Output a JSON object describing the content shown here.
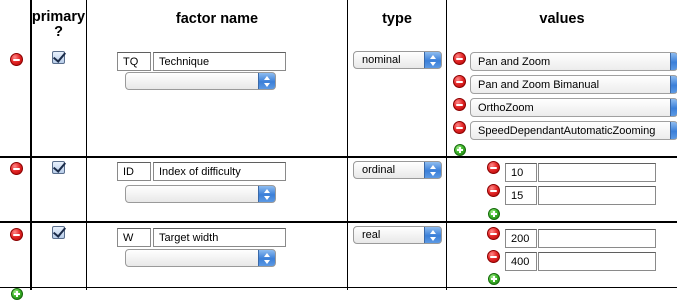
{
  "headers": {
    "primary": "primary",
    "primary_q": "?",
    "factor_name": "factor name",
    "type": "type",
    "values": "values"
  },
  "factors": [
    {
      "primary_checked": true,
      "code": "TQ",
      "name": "Technique",
      "type": "nominal",
      "values": [
        "Pan and Zoom",
        "Pan and Zoom Bimanual",
        "OrthoZoom",
        "SpeedDependantAutomaticZooming"
      ]
    },
    {
      "primary_checked": true,
      "code": "ID",
      "name": "Index of difficulty",
      "type": "ordinal",
      "values": [
        "10",
        "15"
      ]
    },
    {
      "primary_checked": true,
      "code": "W",
      "name": "Target width",
      "type": "real",
      "values": [
        "200",
        "400"
      ]
    }
  ],
  "colors": {
    "remove_button": "#e52a2a",
    "add_button": "#3fb72b",
    "popup_accent": "#3b7fd8"
  },
  "icons": {
    "remove": "minus-circle-icon",
    "add": "plus-circle-icon",
    "popup_arrows": "updown-arrows-icon",
    "checkbox": "checkmark-icon"
  }
}
